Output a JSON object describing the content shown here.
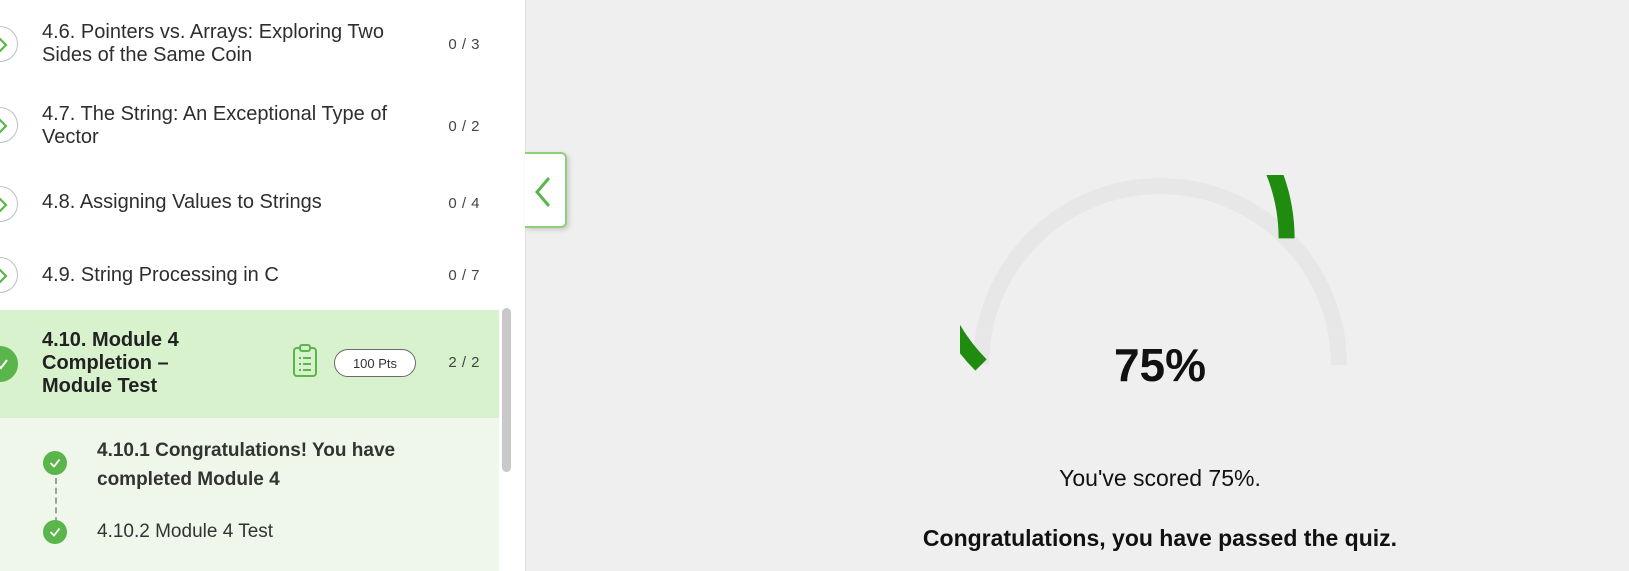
{
  "sidebar": {
    "items": [
      {
        "title": "4.6. Pointers vs. Arrays: Exploring Two Sides of the Same Coin",
        "progress": "0 / 3"
      },
      {
        "title": "4.7. The String: An Exceptional Type of Vector",
        "progress": "0 / 2"
      },
      {
        "title": "4.8. Assigning Values to Strings",
        "progress": "0 / 4"
      },
      {
        "title": "4.9. String Processing in C",
        "progress": "0 / 7"
      },
      {
        "title": "4.10. Module 4 Completion – Module Test",
        "progress": "2 / 2",
        "points": "100 Pts"
      }
    ],
    "subitems": [
      {
        "label": "4.10.1 Congratulations! You have completed Module 4"
      },
      {
        "label": "4.10.2 Module 4 Test"
      }
    ]
  },
  "result": {
    "percent_label": "75%",
    "score_fraction": 0.75,
    "score_text": "You've scored 75%.",
    "pass_text": "Congratulations, you have passed the quiz."
  },
  "colors": {
    "accent": "#1f8c0f",
    "light_green": "#d7f2cc",
    "check_green": "#5ab54a"
  }
}
